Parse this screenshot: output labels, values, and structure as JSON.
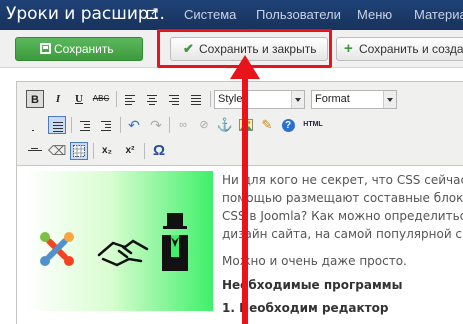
{
  "topbar": {
    "title": "Уроки и расшир...",
    "menu": [
      "Система",
      "Пользователи",
      "Меню",
      "Материа"
    ]
  },
  "toolbar": {
    "save_label": "Сохранить",
    "save_close_label": "Сохранить и закрыть",
    "save_new_label": "Сохранить и созда"
  },
  "editor": {
    "style_select": "Styles",
    "format_select": "Format",
    "tb_bold": "B",
    "tb_italic": "I",
    "tb_underline": "U",
    "tb_strike": "ABC",
    "tb_html": "HTML",
    "tb_sub": "x₂",
    "tb_sup": "x²",
    "tb_omega": "Ω"
  },
  "content": {
    "lines": [
      "Ни для кого не секрет, что CSS сейчас и",
      "помощью размещают составные блоки и",
      "CSS в Joomla? Как можно определиться",
      "дизайн сайта, на самой популярной сист"
    ],
    "line2": "Можно и очень даже просто.",
    "heading": "Необходимые программы",
    "list_item": "1. Необходим редактор"
  },
  "colors": {
    "highlight": "#e8141b",
    "save_green": "#46a546",
    "nav_blue": "#1a3867"
  }
}
